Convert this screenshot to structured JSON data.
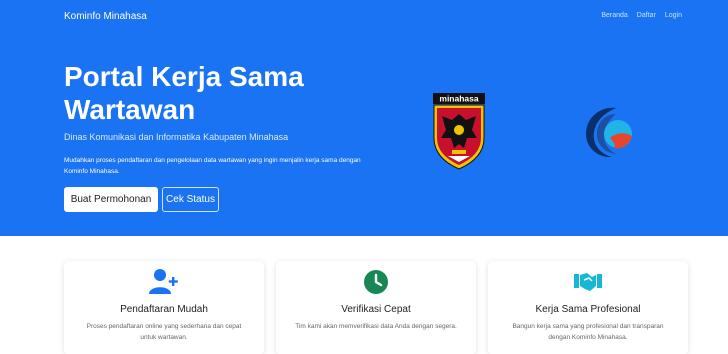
{
  "navbar": {
    "brand": "Kominfo Minahasa",
    "links": [
      {
        "label": "Beranda"
      },
      {
        "label": "Daftar"
      },
      {
        "label": "Login"
      }
    ]
  },
  "hero": {
    "title": "Portal Kerja Sama Wartawan",
    "subtitle": "Dinas Komunikasi dan Informatika Kabupaten Minahasa",
    "description": "Mudahkan proses pendaftaran dan pengelolaan data wartawan yang ingin menjalin kerja sama dengan Kominfo Minahasa.",
    "primary_button": "Buat Permohonan",
    "secondary_button": "Cek Status",
    "logo_text": "minahasa"
  },
  "features": [
    {
      "icon": "user-plus-icon",
      "title": "Pendaftaran Mudah",
      "text": "Proses pendaftaran online yang sederhana dan cepat untuk wartawan."
    },
    {
      "icon": "clock-icon",
      "title": "Verifikasi Cepat",
      "text": "Tim kami akan memverifikasi data Anda dengan segera."
    },
    {
      "icon": "handshake-icon",
      "title": "Kerja Sama Profesional",
      "text": "Bangun kerja sama yang profesional dan transparan dengan Kominfo Minahasa."
    }
  ],
  "colors": {
    "hero_bg": "#1a73f2",
    "user_icon": "#1a73f2",
    "clock_icon": "#198754",
    "handshake_icon": "#14b8d4"
  }
}
